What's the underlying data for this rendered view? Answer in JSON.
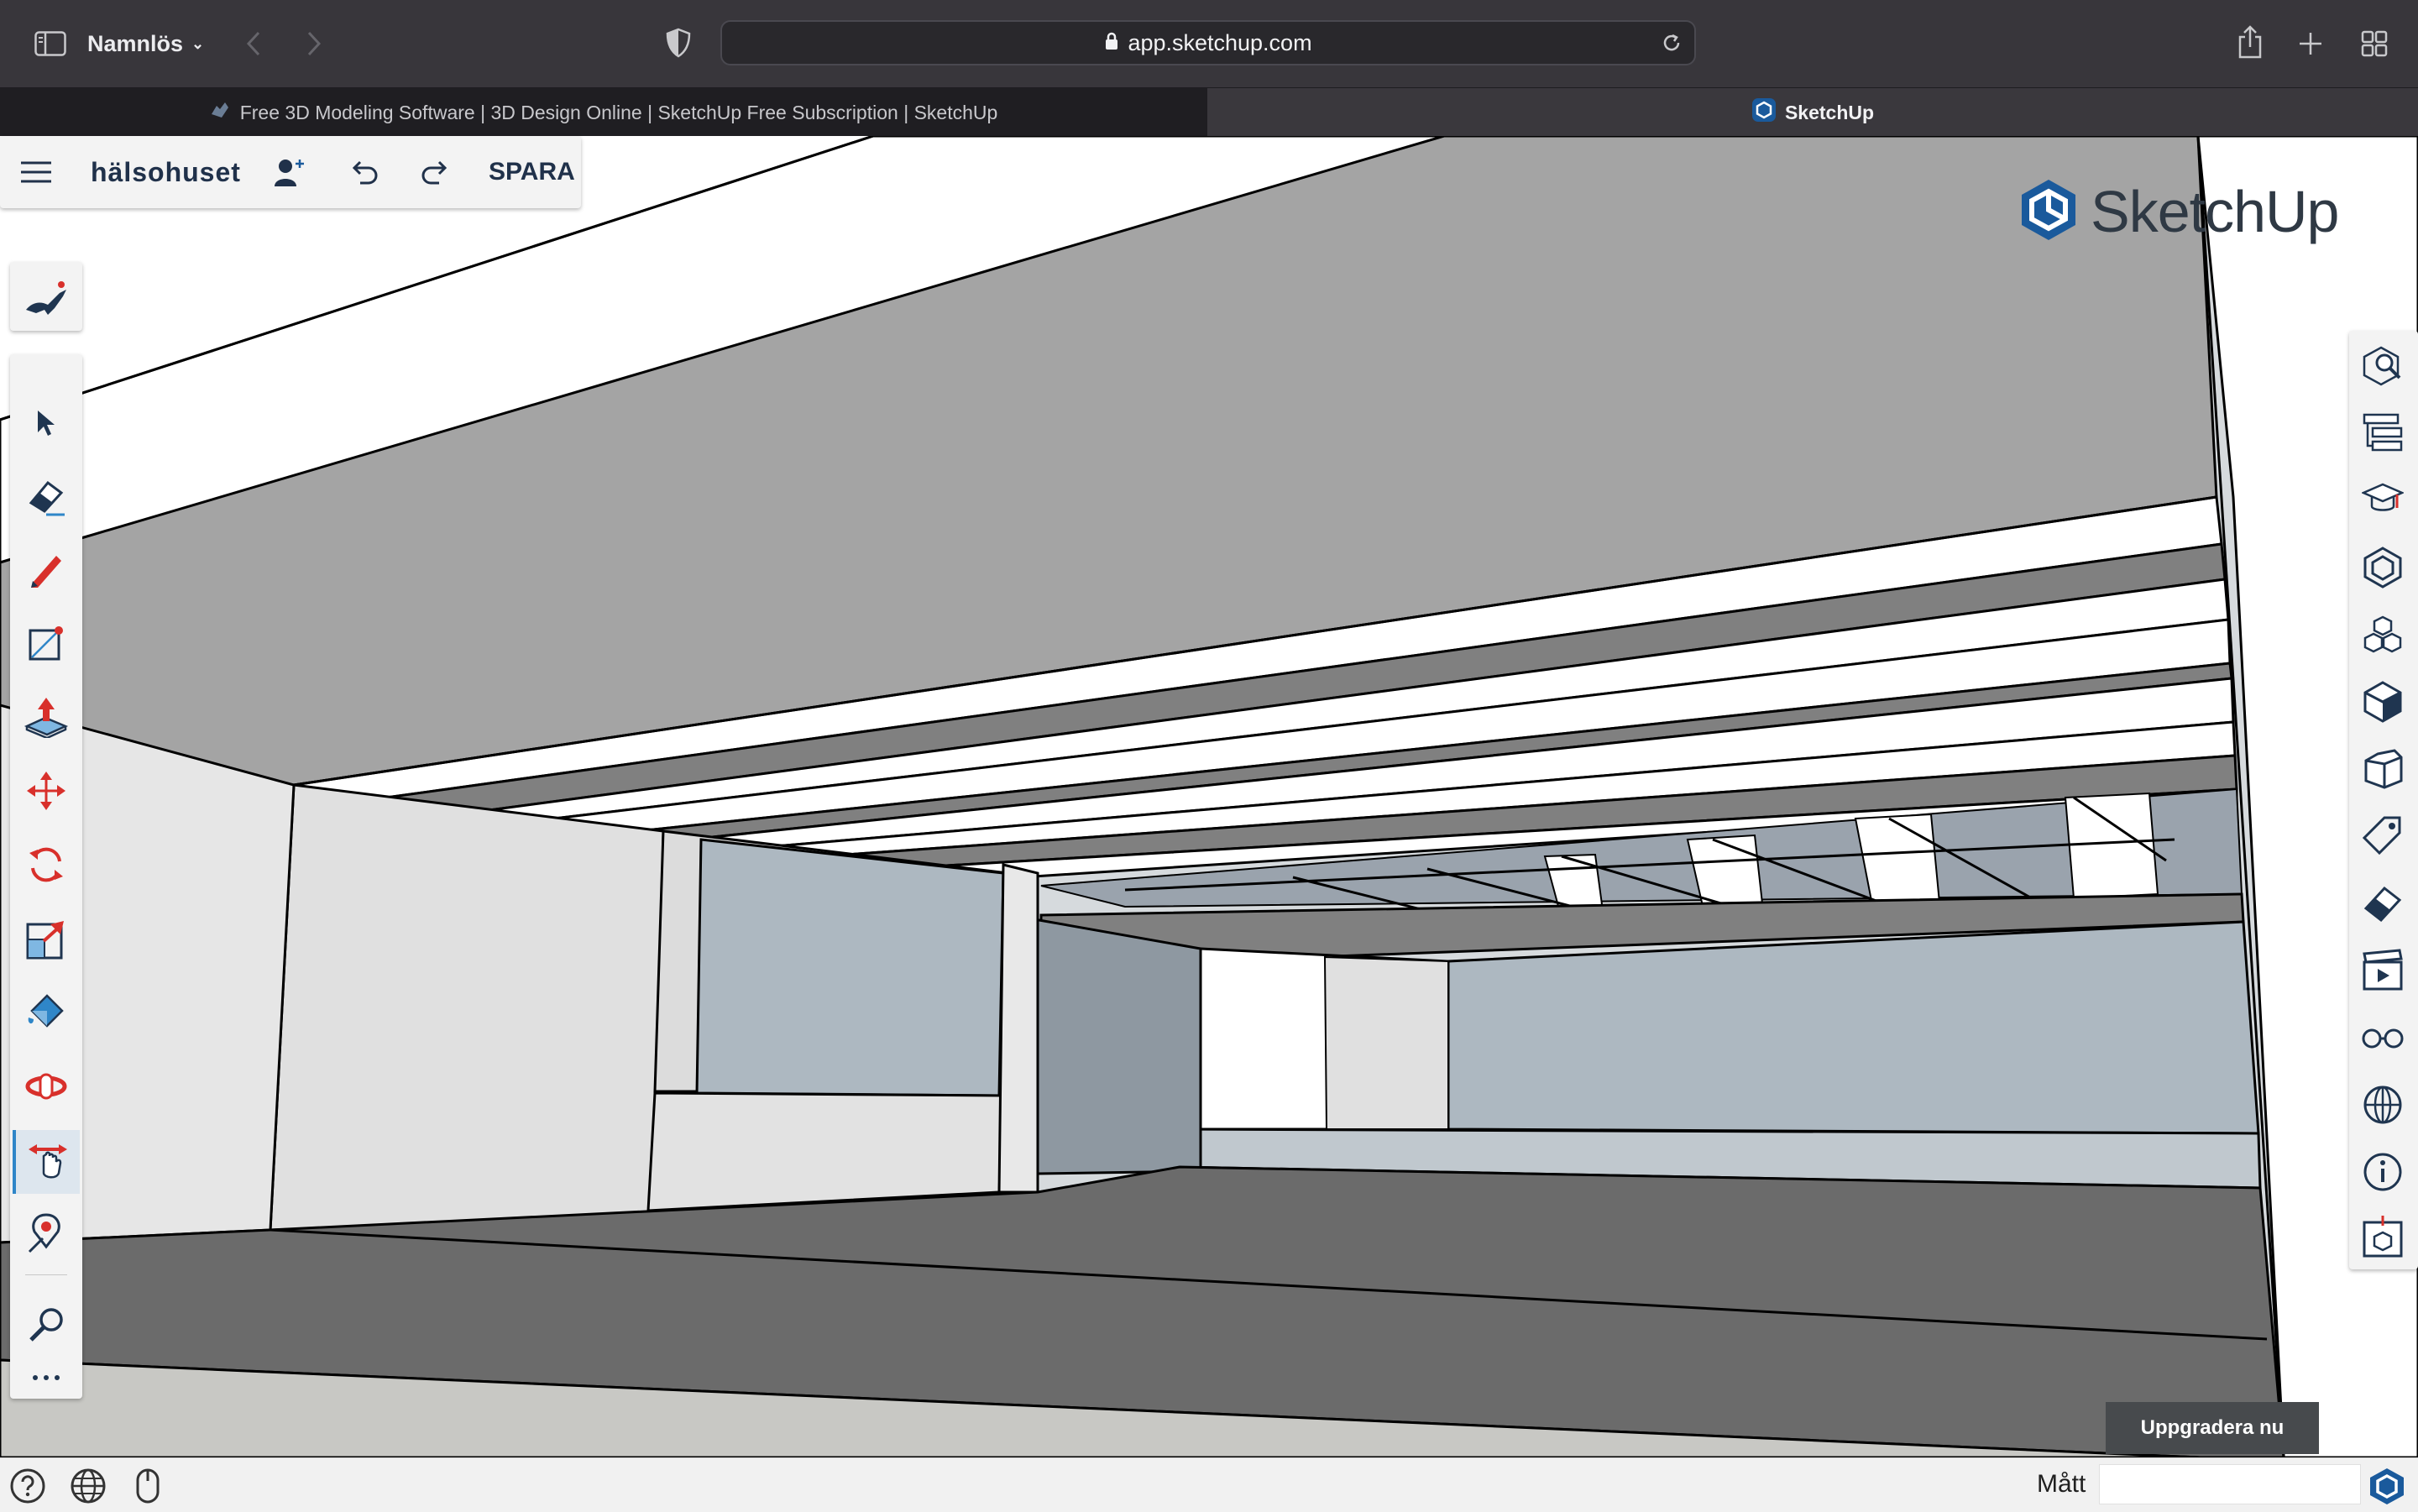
{
  "browser": {
    "window_title": "Namnlös",
    "address": "app.sketchup.com",
    "tabs": [
      {
        "label": "Free 3D Modeling Software | 3D Design Online | SketchUp Free Subscription | SketchUp",
        "active": false
      },
      {
        "label": "SketchUp",
        "active": true
      }
    ]
  },
  "app": {
    "project_title": "hälsohuset",
    "save_label": "SPARA",
    "logo_text": "SketchUp",
    "upgrade_label": "Uppgradera nu",
    "measurements_label": "Mått",
    "measurements_value": "",
    "brand_color": "#1a5a9c",
    "accent_red": "#d8302b"
  },
  "toolbar_left": [
    {
      "name": "select-tool",
      "icon": "arrow-icon"
    },
    {
      "name": "eraser-tool",
      "icon": "eraser-icon"
    },
    {
      "name": "pencil-tool",
      "icon": "pencil-icon"
    },
    {
      "name": "rectangle-tool",
      "icon": "rectangle-icon"
    },
    {
      "name": "push-pull-tool",
      "icon": "push-pull-icon"
    },
    {
      "name": "move-tool",
      "icon": "move-icon"
    },
    {
      "name": "rotate-tool",
      "icon": "rotate-icon"
    },
    {
      "name": "scale-tool",
      "icon": "scale-icon"
    },
    {
      "name": "paint-bucket-tool",
      "icon": "paint-bucket-icon"
    },
    {
      "name": "orbit-tool",
      "icon": "orbit-icon"
    },
    {
      "name": "pan-tool",
      "icon": "pan-hand-icon",
      "active": true
    },
    {
      "name": "position-camera-tool",
      "icon": "position-camera-icon"
    },
    {
      "name": "zoom-tool",
      "icon": "zoom-icon"
    },
    {
      "name": "more-tools",
      "icon": "more-icon"
    }
  ],
  "toolbar_right": [
    "entity-info-icon",
    "outliner-icon",
    "instructor-icon",
    "components-icon",
    "materials-icon",
    "styles-icon",
    "scenes-3d-icon",
    "tags-icon",
    "eraser-styles-icon",
    "animation-icon",
    "display-icon",
    "geolocation-icon",
    "model-info-icon",
    "3d-warehouse-icon"
  ]
}
